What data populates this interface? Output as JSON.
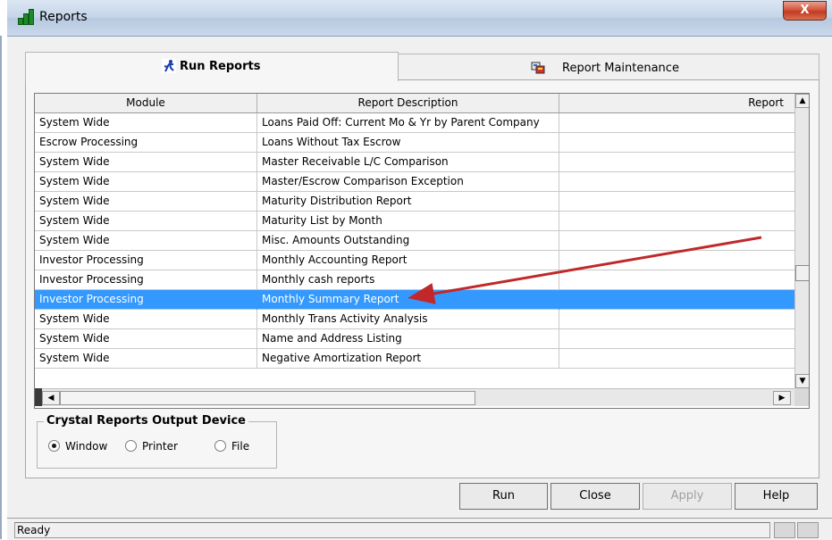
{
  "window": {
    "title": "Reports",
    "close_label": "X"
  },
  "tabs": [
    {
      "label": "Run Reports",
      "active": true
    },
    {
      "label": "Report Maintenance",
      "active": false
    }
  ],
  "grid": {
    "columns": [
      "Module",
      "Report Description",
      "Report"
    ],
    "rows": [
      {
        "module": "System Wide",
        "description": "Loans Paid Off: Current Mo & Yr by Parent Company",
        "report": ""
      },
      {
        "module": "Escrow Processing",
        "description": "Loans Without Tax Escrow",
        "report": ""
      },
      {
        "module": "System Wide",
        "description": "Master Receivable L/C Comparison",
        "report": ""
      },
      {
        "module": "System Wide",
        "description": "Master/Escrow Comparison Exception",
        "report": ""
      },
      {
        "module": "System Wide",
        "description": "Maturity Distribution Report",
        "report": ""
      },
      {
        "module": "System Wide",
        "description": "Maturity List by Month",
        "report": ""
      },
      {
        "module": "System Wide",
        "description": "Misc. Amounts Outstanding",
        "report": ""
      },
      {
        "module": "Investor Processing",
        "description": "Monthly Accounting Report",
        "report": ""
      },
      {
        "module": "Investor Processing",
        "description": "Monthly cash reports",
        "report": ""
      },
      {
        "module": "Investor Processing",
        "description": "Monthly Summary Report",
        "report": "",
        "selected": true
      },
      {
        "module": "System Wide",
        "description": "Monthly Trans Activity Analysis",
        "report": ""
      },
      {
        "module": "System Wide",
        "description": "Name and Address Listing",
        "report": ""
      },
      {
        "module": "System Wide",
        "description": "Negative Amortization Report",
        "report": ""
      }
    ]
  },
  "output_device": {
    "title": "Crystal Reports Output Device",
    "options": [
      {
        "label": "Window",
        "checked": true
      },
      {
        "label": "Printer",
        "checked": false
      },
      {
        "label": "File",
        "checked": false
      }
    ]
  },
  "buttons": {
    "run": "Run",
    "close": "Close",
    "apply": "Apply",
    "help": "Help"
  },
  "status": {
    "text": "Ready"
  },
  "colors": {
    "selection": "#3399ff",
    "annotation_arrow": "#c0282a"
  }
}
